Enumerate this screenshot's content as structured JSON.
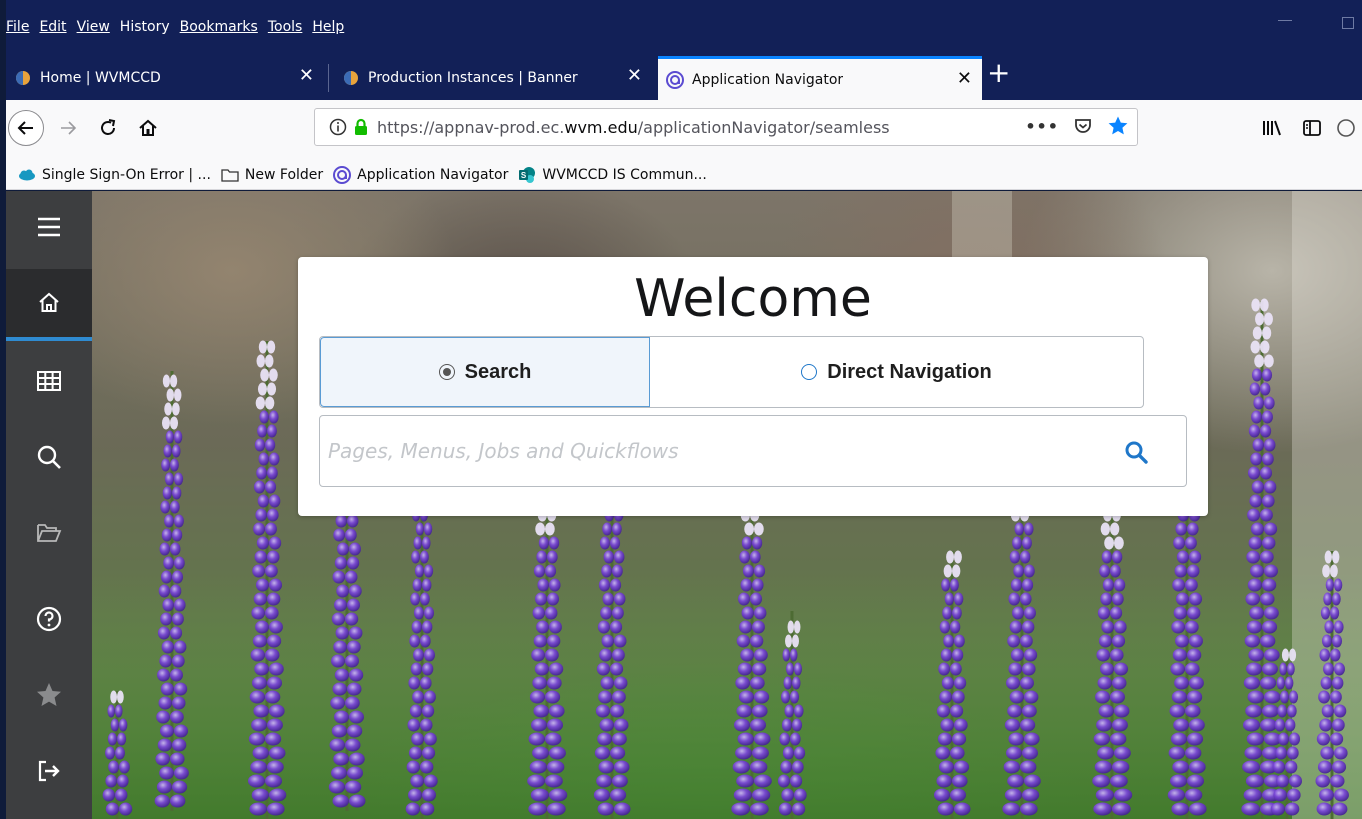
{
  "menubar": {
    "items": [
      "File",
      "Edit",
      "View",
      "History",
      "Bookmarks",
      "Tools",
      "Help"
    ]
  },
  "tabs": [
    {
      "title": "Home | WVMCCD",
      "icon": "wvm-logo-icon",
      "active": false
    },
    {
      "title": "Production Instances | Banner",
      "icon": "wvm-logo-icon",
      "active": false
    },
    {
      "title": "Application Navigator",
      "icon": "app-navigator-icon",
      "active": true
    }
  ],
  "newtab_label": "+",
  "url": {
    "prefix": "https://appnav-prod.ec.",
    "domain": "wvm.edu",
    "path": "/applicationNavigator/seamless",
    "more_label": "•••"
  },
  "bookmarks": [
    {
      "label": "Single Sign-On Error | ...",
      "icon": "salesforce-cloud-icon"
    },
    {
      "label": "New Folder",
      "icon": "folder-icon"
    },
    {
      "label": "Application Navigator",
      "icon": "app-navigator-icon"
    },
    {
      "label": "WVMCCD IS Commun...",
      "icon": "sharepoint-icon"
    }
  ],
  "sidebar": {
    "items": [
      {
        "name": "menu",
        "icon": "hamburger-icon"
      },
      {
        "name": "home",
        "icon": "home-icon",
        "active": true
      },
      {
        "name": "applications",
        "icon": "grid-icon"
      },
      {
        "name": "search",
        "icon": "search-icon"
      },
      {
        "name": "recent",
        "icon": "folder-open-icon"
      },
      {
        "name": "help",
        "icon": "help-icon"
      },
      {
        "name": "favorites",
        "icon": "star-icon"
      },
      {
        "name": "sign-out",
        "icon": "sign-out-icon"
      }
    ]
  },
  "welcome": {
    "title": "Welcome",
    "modes": {
      "search_label": "Search",
      "direct_label": "Direct Navigation",
      "selected": "Search"
    },
    "search": {
      "placeholder": "Pages, Menus, Jobs and Quickflows",
      "value": ""
    }
  },
  "colors": {
    "accent": "#0a84ff",
    "sidebar": "#3d3e40",
    "chrome_dark": "#122057",
    "search_icon": "#1f77c9"
  }
}
